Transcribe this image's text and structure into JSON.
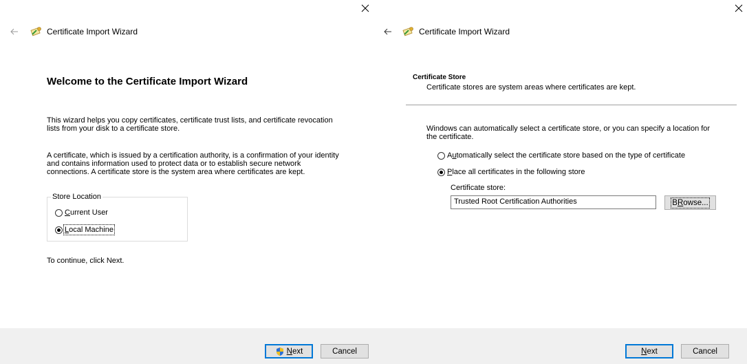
{
  "left": {
    "title": "Certificate Import Wizard",
    "heading": "Welcome to the Certificate Import Wizard",
    "intro_line1": "This wizard helps you copy certificates, certificate trust lists, and certificate revocation",
    "intro_line2": "lists from your disk to a certificate store.",
    "info_line1": "A certificate, which is issued by a certification authority, is a confirmation of your identity",
    "info_line2": "and contains information used to protect data or to establish secure network",
    "info_line3": "connections. A certificate store is the system area where certificates are kept.",
    "store_location_legend": "Store Location",
    "options": [
      {
        "label_accel": "C",
        "label_rest": "urrent User",
        "selected": false
      },
      {
        "label_accel": "L",
        "label_rest": "ocal Machine",
        "selected": true
      }
    ],
    "continue_text": "To continue, click Next.",
    "next_accel": "N",
    "next_rest": "ext",
    "cancel_label": "Cancel"
  },
  "right": {
    "title": "Certificate Import Wizard",
    "section_title": "Certificate Store",
    "section_subtitle": "Certificate stores are system areas where certificates are kept.",
    "desc_line1": "Windows can automatically select a certificate store, or you can specify a location for",
    "desc_line2": "the certificate.",
    "options": [
      {
        "pre": "A",
        "accel": "u",
        "rest": "tomatically select the certificate store based on the type of certificate",
        "selected": false
      },
      {
        "pre": "",
        "accel": "P",
        "rest": "lace all certificates in the following store",
        "selected": true
      }
    ],
    "store_label": "Certificate store:",
    "store_value": "Trusted Root Certification Authorities",
    "browse_accel": "R",
    "browse_pre": "B",
    "browse_rest": "owse...",
    "next_accel": "N",
    "next_rest": "ext",
    "cancel_label": "Cancel"
  },
  "colors": {
    "footer_bg": "#f0f0f0",
    "button_bg": "#e1e1e1",
    "accent": "#0078d7"
  },
  "icons": [
    "close-icon",
    "back-arrow-icon",
    "certificate-icon",
    "uac-shield-icon"
  ]
}
